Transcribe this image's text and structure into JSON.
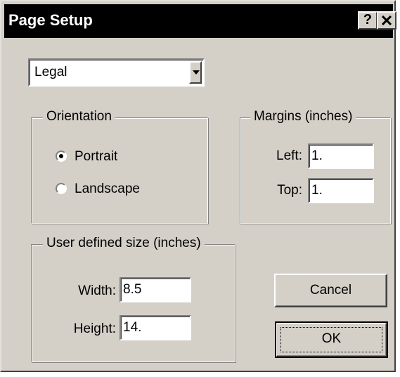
{
  "dialog": {
    "title": "Page Setup",
    "help_label": "?",
    "close_label": "×"
  },
  "paper_size": {
    "selected": "Legal"
  },
  "orientation": {
    "label": "Orientation",
    "options": [
      {
        "label": "Portrait",
        "checked": true
      },
      {
        "label": "Landscape",
        "checked": false
      }
    ]
  },
  "margins": {
    "label": "Margins (inches)",
    "left_label": "Left:",
    "left_value": "1.",
    "top_label": "Top:",
    "top_value": "1."
  },
  "user_size": {
    "label": "User defined size (inches)",
    "width_label": "Width:",
    "width_value": "8.5",
    "height_label": "Height:",
    "height_value": "14."
  },
  "buttons": {
    "cancel": "Cancel",
    "ok": "OK"
  }
}
